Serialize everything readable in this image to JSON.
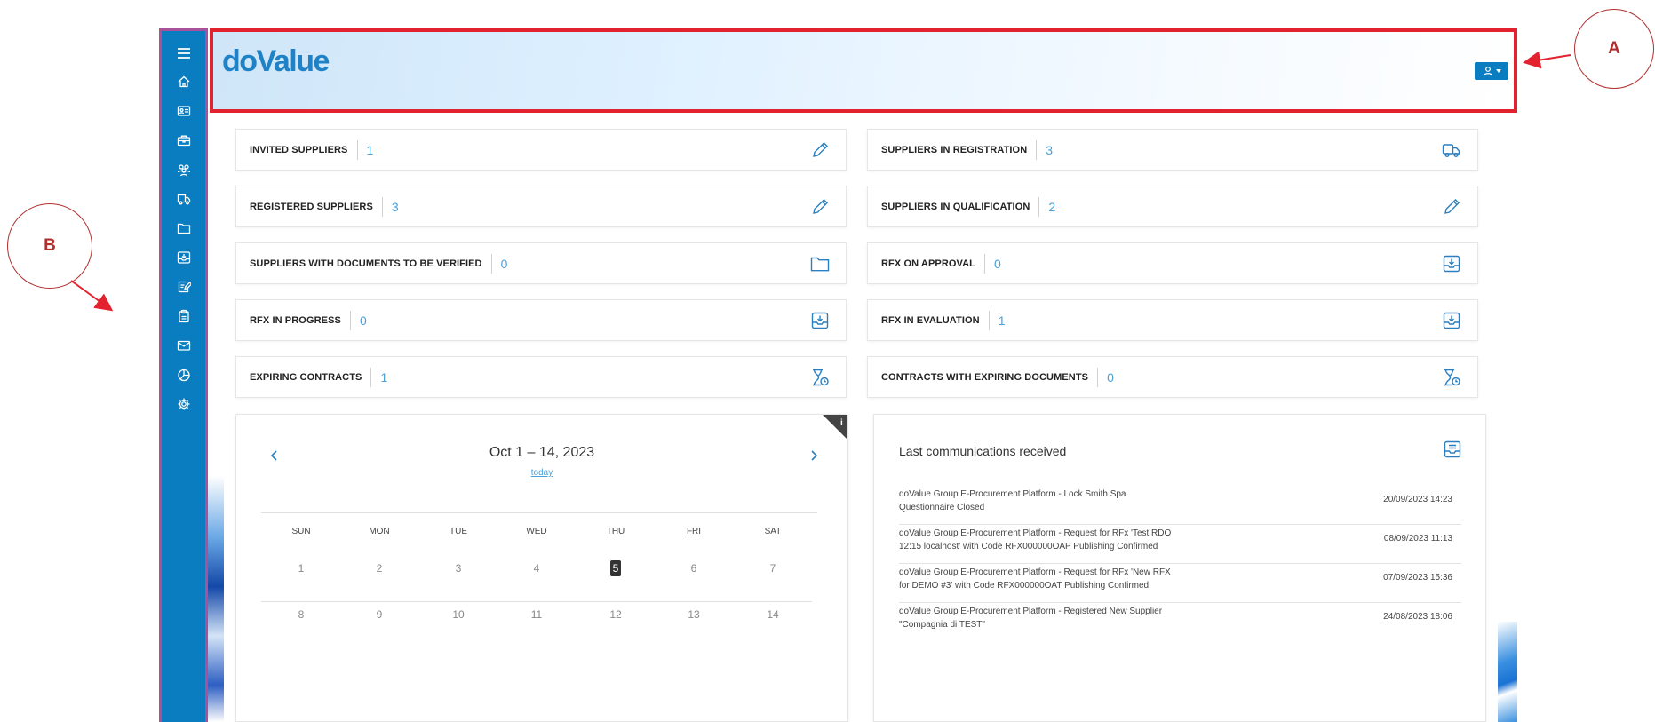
{
  "colors": {
    "accent": "#0a7dc0",
    "sidebar_border": "#a8529c",
    "header_border": "#e32230",
    "callout": "#b03030",
    "stat_value": "#4aa0d8"
  },
  "header": {
    "logo": "doValue",
    "user_menu_icon": "user-icon"
  },
  "callouts": {
    "a": "A",
    "b": "B"
  },
  "sidebar": {
    "items": [
      {
        "icon": "menu-icon"
      },
      {
        "icon": "home-icon"
      },
      {
        "icon": "id-card-icon"
      },
      {
        "icon": "briefcase-icon"
      },
      {
        "icon": "users-icon"
      },
      {
        "icon": "truck-icon"
      },
      {
        "icon": "folder-icon"
      },
      {
        "icon": "inbox-download-icon"
      },
      {
        "icon": "edit-document-icon"
      },
      {
        "icon": "clipboard-icon"
      },
      {
        "icon": "mail-icon"
      },
      {
        "icon": "pie-chart-icon"
      },
      {
        "icon": "gear-icon"
      }
    ]
  },
  "stats": [
    {
      "label": "INVITED SUPPLIERS",
      "value": "1",
      "icon": "pencil-icon"
    },
    {
      "label": "SUPPLIERS IN REGISTRATION",
      "value": "3",
      "icon": "truck-icon"
    },
    {
      "label": "REGISTERED SUPPLIERS",
      "value": "3",
      "icon": "pencil-icon"
    },
    {
      "label": "SUPPLIERS IN QUALIFICATION",
      "value": "2",
      "icon": "pencil-icon"
    },
    {
      "label": "SUPPLIERS WITH DOCUMENTS TO BE VERIFIED",
      "value": "0",
      "icon": "folder-icon"
    },
    {
      "label": "RFX ON APPROVAL",
      "value": "0",
      "icon": "inbox-download-icon"
    },
    {
      "label": "RFX IN PROGRESS",
      "value": "0",
      "icon": "inbox-download-icon"
    },
    {
      "label": "RFX IN EVALUATION",
      "value": "1",
      "icon": "inbox-download-icon"
    },
    {
      "label": "EXPIRING CONTRACTS",
      "value": "1",
      "icon": "hourglass-clock-icon"
    },
    {
      "label": "CONTRACTS WITH EXPIRING DOCUMENTS",
      "value": "0",
      "icon": "hourglass-clock-icon"
    }
  ],
  "calendar": {
    "info_glyph": "i",
    "title": "Oct 1 – 14, 2023",
    "today_link": "today",
    "weekdays": [
      "SUN",
      "MON",
      "TUE",
      "WED",
      "THU",
      "FRI",
      "SAT"
    ],
    "week1": [
      "1",
      "2",
      "3",
      "4",
      "5",
      "6",
      "7"
    ],
    "week2": [
      "8",
      "9",
      "10",
      "11",
      "12",
      "13",
      "14"
    ],
    "highlighted_day": "5"
  },
  "communications": {
    "title": "Last communications received",
    "icon": "inbox-message-icon",
    "items": [
      {
        "line1": "doValue Group E-Procurement Platform - Lock Smith Spa",
        "line2": "Questionnaire Closed",
        "date": "20/09/2023 14:23"
      },
      {
        "line1": "doValue Group E-Procurement Platform - Request for RFx 'Test RDO",
        "line2": "12:15 localhost' with Code RFX000000OAP Publishing Confirmed",
        "date": "08/09/2023 11:13"
      },
      {
        "line1": "doValue Group E-Procurement Platform - Request for RFx 'New RFX",
        "line2": "for DEMO #3' with Code RFX000000OAT Publishing Confirmed",
        "date": "07/09/2023 15:36"
      },
      {
        "line1": "doValue Group E-Procurement Platform - Registered New Supplier",
        "line2": "\"Compagnia di TEST\"",
        "date": "24/08/2023 18:06"
      }
    ]
  }
}
